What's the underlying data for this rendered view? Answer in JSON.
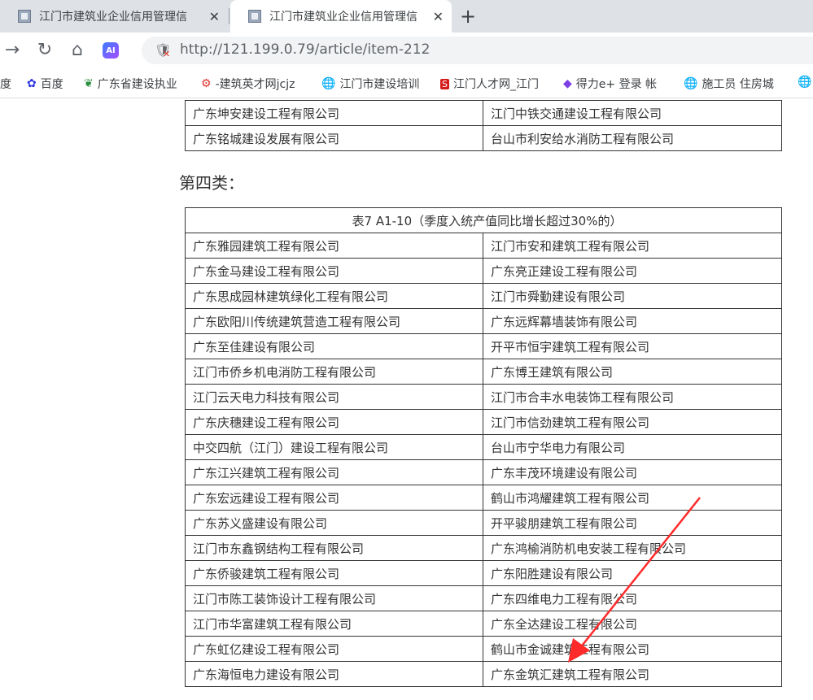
{
  "tabs": [
    {
      "title": "江门市建筑业企业信用管理信",
      "close": "✕"
    },
    {
      "title": "江门市建筑业企业信用管理信",
      "close": "✕"
    }
  ],
  "newtab_label": "+",
  "toolbar": {
    "back": "→",
    "reload": "↻",
    "home": "⌂",
    "ai_label": "AI",
    "url": "http://121.199.0.79/article/item-212"
  },
  "bookmarks": [
    {
      "label": "度",
      "icon": ""
    },
    {
      "label": "百度",
      "icon": "baidu-paw-icon"
    },
    {
      "label": "广东省建设执业",
      "icon": "leaf-icon"
    },
    {
      "label": "-建筑英才网jcjz",
      "icon": "gear-icon"
    },
    {
      "label": "江门市建设培训",
      "icon": "globe-icon"
    },
    {
      "label": "江门人才网_江门",
      "icon": "red-logo-icon"
    },
    {
      "label": "得力e+ 登录 帐",
      "icon": "purple-logo-icon"
    },
    {
      "label": "施工员  住房城",
      "icon": "globe-icon"
    },
    {
      "label": "",
      "icon": "globe-icon"
    }
  ],
  "top_table": {
    "rows": [
      [
        "广东坤安建设工程有限公司",
        "江门中铁交通建设工程有限公司"
      ],
      [
        "广东铭城建设发展有限公司",
        "台山市利安给水消防工程有限公司"
      ]
    ]
  },
  "heading": "第四类：",
  "table7": {
    "caption": "表7  A1-10（季度入统产值同比增长超过30%的）",
    "rows": [
      [
        "广东雅园建筑工程有限公司",
        "江门市安和建筑工程有限公司"
      ],
      [
        "广东金马建设工程有限公司",
        "广东亮正建设工程有限公司"
      ],
      [
        "广东思成园林建筑绿化工程有限公司",
        "江门市舜勤建设有限公司"
      ],
      [
        "广东欧阳川传统建筑营造工程有限公司",
        "广东远辉幕墙装饰有限公司"
      ],
      [
        "广东至佳建设有限公司",
        "开平市恒宇建筑工程有限公司"
      ],
      [
        "江门市侨乡机电消防工程有限公司",
        "广东博王建筑有限公司"
      ],
      [
        "江门云天电力科技有限公司",
        "江门市合丰水电装饰工程有限公司"
      ],
      [
        "广东庆穗建设工程有限公司",
        "江门市信劲建筑工程有限公司"
      ],
      [
        "中交四航（江门）建设工程有限公司",
        "台山市宁华电力有限公司"
      ],
      [
        "广东江兴建筑工程有限公司",
        "广东丰茂环境建设有限公司"
      ],
      [
        "广东宏远建设工程有限公司",
        "鹤山市鸿耀建筑工程有限公司"
      ],
      [
        "广东苏义盛建设有限公司",
        "开平骏朋建筑工程有限公司"
      ],
      [
        "江门市东鑫钢结构工程有限公司",
        "广东鸿榆消防机电安装工程有限公司"
      ],
      [
        "广东侨骏建筑工程有限公司",
        "广东阳胜建设有限公司"
      ],
      [
        "江门市陈工装饰设计工程有限公司",
        "广东四维电力工程有限公司"
      ],
      [
        "江门市华富建筑工程有限公司",
        "广东全达建设工程有限公司"
      ],
      [
        "广东虹亿建设工程有限公司",
        "鹤山市金诚建筑工程有限公司"
      ],
      [
        "广东海恒电力建设有限公司",
        "广东金筑汇建筑工程有限公司"
      ]
    ]
  },
  "colors": {
    "arrow": "#ff2a2a",
    "tabstrip": "#dee1e6"
  }
}
